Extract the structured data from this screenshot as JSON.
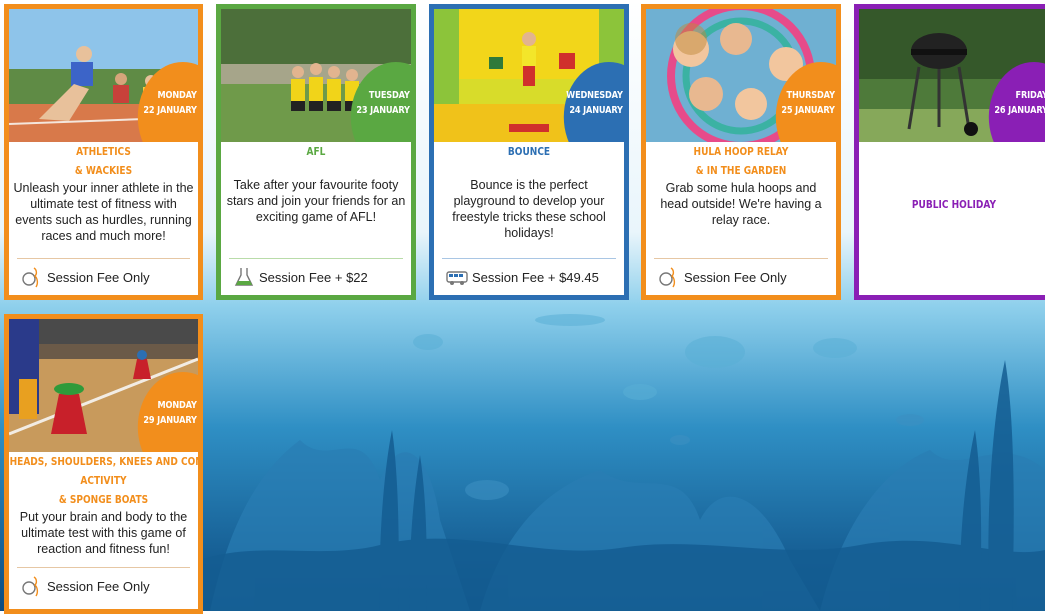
{
  "colors": {
    "orange": "#f28e1c",
    "green": "#5aa842",
    "blue": "#2c6fb3",
    "purple": "#8a1fb5"
  },
  "cards": [
    {
      "day": "MONDAY",
      "date": "22 JANUARY",
      "title_line1": "ATHLETICS",
      "title_line2": "& WACKIES",
      "description": "Unleash your inner athlete in the ultimate test of fitness with events such as hurdles, running races and much more!",
      "fee": "Session Fee Only",
      "fee_icon": "bowling-icon"
    },
    {
      "day": "TUESDAY",
      "date": "23 JANUARY",
      "title_line1": "AFL",
      "description": "Take after your favourite footy stars and join your friends for an exciting game of AFL!",
      "fee": "Session Fee + $22",
      "fee_icon": "flask-icon"
    },
    {
      "day": "WEDNESDAY",
      "date": "24 JANUARY",
      "title_line1": "BOUNCE",
      "description": "Bounce is the perfect playground to develop your freestyle tricks these school holidays!",
      "fee": "Session Fee + $49.45",
      "fee_icon": "bus-icon"
    },
    {
      "day": "THURSDAY",
      "date": "25 JANUARY",
      "title_line1": "HULA HOOP RELAY",
      "title_line2": "& IN THE GARDEN",
      "description": "Grab some hula hoops and head outside! We're having a relay race.",
      "fee": "Session Fee Only",
      "fee_icon": "bowling-icon"
    },
    {
      "day": "FRIDAY",
      "date": "26 JANUARY",
      "title_line1": "PUBLIC HOLIDAY"
    },
    {
      "day": "MONDAY",
      "date": "29 JANUARY",
      "title_line1": "HEADS, SHOULDERS, KNEES AND CONE",
      "title_line2": "ACTIVITY",
      "title_line3": "& SPONGE BOATS",
      "description": "Put your brain and body to the ultimate test with this game of reaction and fitness fun!",
      "fee": "Session Fee Only",
      "fee_icon": "bowling-icon"
    }
  ]
}
